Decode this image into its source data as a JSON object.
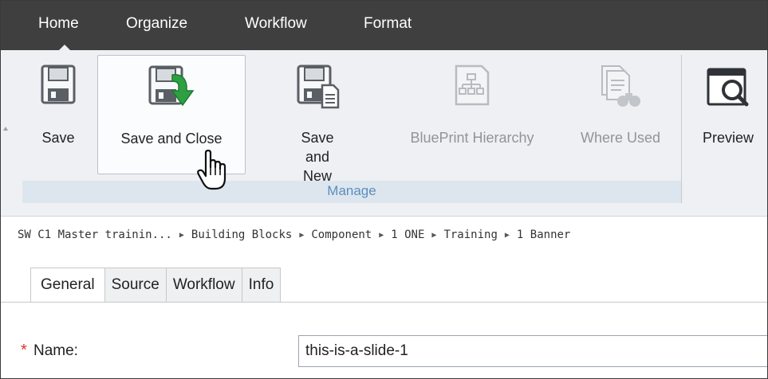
{
  "menu": {
    "tabs": [
      "Home",
      "Organize",
      "Workflow",
      "Format"
    ],
    "active": "Home"
  },
  "ribbon": {
    "buttons": [
      {
        "label": "Save",
        "icon": "floppy-disk-icon",
        "enabled": true
      },
      {
        "label": "Save and Close",
        "icon": "floppy-disk-arrow-icon",
        "enabled": true
      },
      {
        "label": "Save and New",
        "icon": "floppy-disk-document-icon",
        "enabled": true
      },
      {
        "label": "BluePrint Hierarchy",
        "icon": "hierarchy-icon",
        "enabled": false
      },
      {
        "label": "Where Used",
        "icon": "binoculars-document-icon",
        "enabled": false
      },
      {
        "label": "Preview",
        "icon": "preview-magnifier-icon",
        "enabled": true
      }
    ],
    "group_label": "Manage",
    "hovered_button": "Save and Close"
  },
  "breadcrumb": [
    "SW C1 Master trainin...",
    "Building Blocks",
    "Component",
    "1 ONE",
    "Training",
    "1 Banner"
  ],
  "tabs": [
    "General",
    "Source",
    "Workflow",
    "Info"
  ],
  "active_tab": "General",
  "form": {
    "required_marker": "*",
    "name_label": "Name:",
    "name_value": "this-is-a-slide-1"
  },
  "colors": {
    "menubar": "#3f3f3f",
    "ribbon": "#eef0f3",
    "group_footer": "#dde6ee",
    "group_label": "#5b8dbf",
    "required": "#d9342b",
    "arrow_green": "#2ea043"
  }
}
